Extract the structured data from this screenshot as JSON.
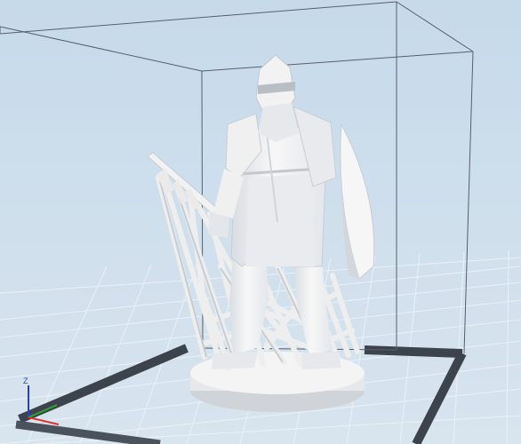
{
  "viewport": {
    "background_top": "#c8dbeb",
    "background_bottom": "#dbe6f0",
    "grid_color": "#ffffff",
    "frame_color": "#5b6775",
    "bed_border_color": "#3f4650",
    "model_color": "#f2f2f2",
    "model_shade": "#cfd3d8"
  },
  "axis_indicator": {
    "z_label": "Z",
    "z_color": "#2a3fbf",
    "x_color": "#d33",
    "y_color": "#2ba82b"
  }
}
